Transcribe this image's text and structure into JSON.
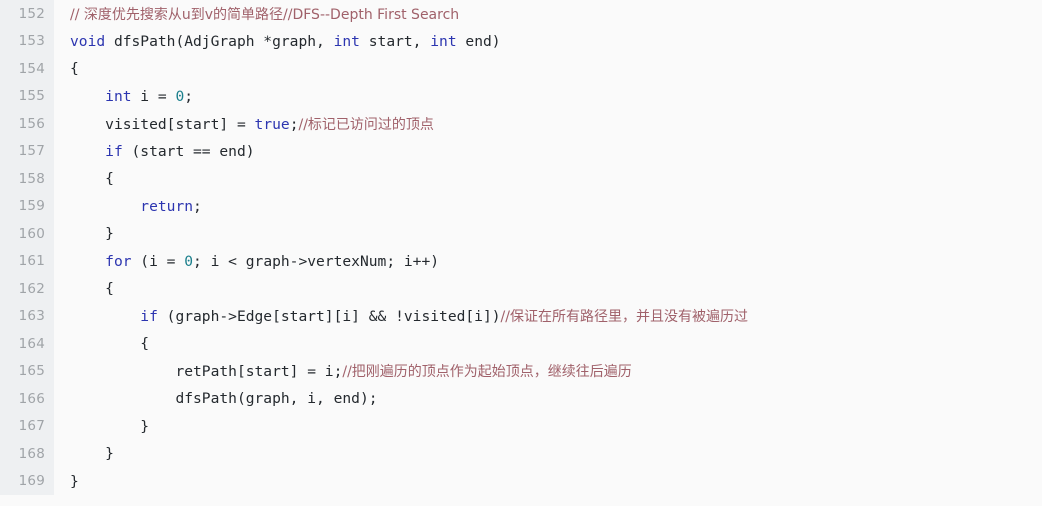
{
  "viewer": {
    "name": "code-listing",
    "language": "C",
    "background_color": "#fafafa",
    "gutter_color": "#eef0f2",
    "gutter_text_color": "#a0a4a8",
    "text_color": "#24292e",
    "keyword_color": "#2c35b0",
    "number_color": "#1b7f8c",
    "comment_color": "#a0616a",
    "first_line_number": 152,
    "last_line_number": 169,
    "total_lines": 18
  },
  "lines": [
    {
      "number": "152",
      "indent": "",
      "tokens": [
        {
          "kind": "comment",
          "text": "// 深度优先搜索从u到v的简单路径//DFS--Depth First Search"
        }
      ]
    },
    {
      "number": "153",
      "indent": "",
      "tokens": [
        {
          "kind": "keyword",
          "text": "void"
        },
        {
          "kind": "plain",
          "text": " dfsPath(AdjGraph *graph, "
        },
        {
          "kind": "keyword",
          "text": "int"
        },
        {
          "kind": "plain",
          "text": " start, "
        },
        {
          "kind": "keyword",
          "text": "int"
        },
        {
          "kind": "plain",
          "text": " end)"
        }
      ]
    },
    {
      "number": "154",
      "indent": "",
      "tokens": [
        {
          "kind": "plain",
          "text": "{"
        }
      ]
    },
    {
      "number": "155",
      "indent": "    ",
      "tokens": [
        {
          "kind": "keyword",
          "text": "int"
        },
        {
          "kind": "plain",
          "text": " i = "
        },
        {
          "kind": "number",
          "text": "0"
        },
        {
          "kind": "plain",
          "text": ";"
        }
      ]
    },
    {
      "number": "156",
      "indent": "    ",
      "tokens": [
        {
          "kind": "plain",
          "text": "visited[start] = "
        },
        {
          "kind": "keyword",
          "text": "true"
        },
        {
          "kind": "plain",
          "text": ";"
        },
        {
          "kind": "comment",
          "text": "//标记已访问过的顶点"
        }
      ]
    },
    {
      "number": "157",
      "indent": "    ",
      "tokens": [
        {
          "kind": "keyword",
          "text": "if"
        },
        {
          "kind": "plain",
          "text": " (start == end)"
        }
      ]
    },
    {
      "number": "158",
      "indent": "    ",
      "tokens": [
        {
          "kind": "plain",
          "text": "{"
        }
      ]
    },
    {
      "number": "159",
      "indent": "        ",
      "tokens": [
        {
          "kind": "keyword",
          "text": "return"
        },
        {
          "kind": "plain",
          "text": ";"
        }
      ]
    },
    {
      "number": "160",
      "indent": "    ",
      "tokens": [
        {
          "kind": "plain",
          "text": "}"
        }
      ]
    },
    {
      "number": "161",
      "indent": "    ",
      "tokens": [
        {
          "kind": "keyword",
          "text": "for"
        },
        {
          "kind": "plain",
          "text": " (i = "
        },
        {
          "kind": "number",
          "text": "0"
        },
        {
          "kind": "plain",
          "text": "; i < graph->vertexNum; i++)"
        }
      ]
    },
    {
      "number": "162",
      "indent": "    ",
      "tokens": [
        {
          "kind": "plain",
          "text": "{"
        }
      ]
    },
    {
      "number": "163",
      "indent": "        ",
      "tokens": [
        {
          "kind": "keyword",
          "text": "if"
        },
        {
          "kind": "plain",
          "text": " (graph->Edge[start][i] && !visited[i])"
        },
        {
          "kind": "comment",
          "text": "//保证在所有路径里，并且没有被遍历过"
        }
      ]
    },
    {
      "number": "164",
      "indent": "        ",
      "tokens": [
        {
          "kind": "plain",
          "text": "{"
        }
      ]
    },
    {
      "number": "165",
      "indent": "            ",
      "tokens": [
        {
          "kind": "plain",
          "text": "retPath[start] = i;"
        },
        {
          "kind": "comment",
          "text": "//把刚遍历的顶点作为起始顶点，继续往后遍历"
        }
      ]
    },
    {
      "number": "166",
      "indent": "            ",
      "tokens": [
        {
          "kind": "plain",
          "text": "dfsPath(graph, i, end);"
        }
      ]
    },
    {
      "number": "167",
      "indent": "        ",
      "tokens": [
        {
          "kind": "plain",
          "text": "}"
        }
      ]
    },
    {
      "number": "168",
      "indent": "    ",
      "tokens": [
        {
          "kind": "plain",
          "text": "}"
        }
      ]
    },
    {
      "number": "169",
      "indent": "",
      "tokens": [
        {
          "kind": "plain",
          "text": "}"
        }
      ]
    }
  ]
}
